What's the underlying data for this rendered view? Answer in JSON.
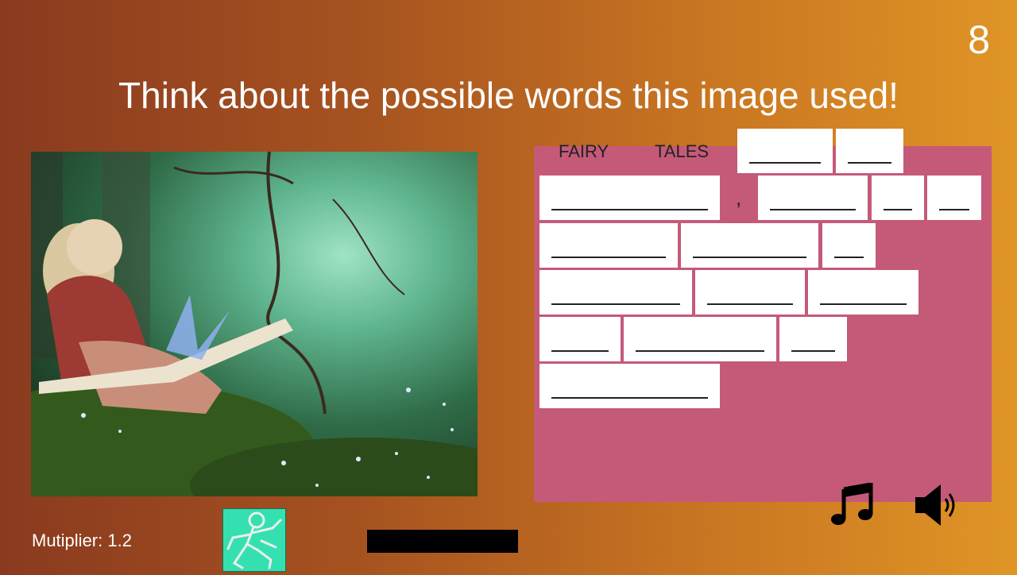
{
  "timer": "8",
  "prompt": "Think about the possible words this image used!",
  "puzzle": {
    "revealed_words": [
      "FAIRY",
      "TALES"
    ],
    "comma": ","
  },
  "status": {
    "multiplier_text": "Mutiplier: 1.2"
  },
  "progress": 0,
  "colors": {
    "board": "#c55a78",
    "slot": "#ffffff",
    "hint_card": "#35e0b0",
    "progress_bar": "#000000"
  },
  "icons": {
    "music": "music-note-icon",
    "sound": "speaker-icon",
    "hint": "dancer-sketch-icon"
  }
}
